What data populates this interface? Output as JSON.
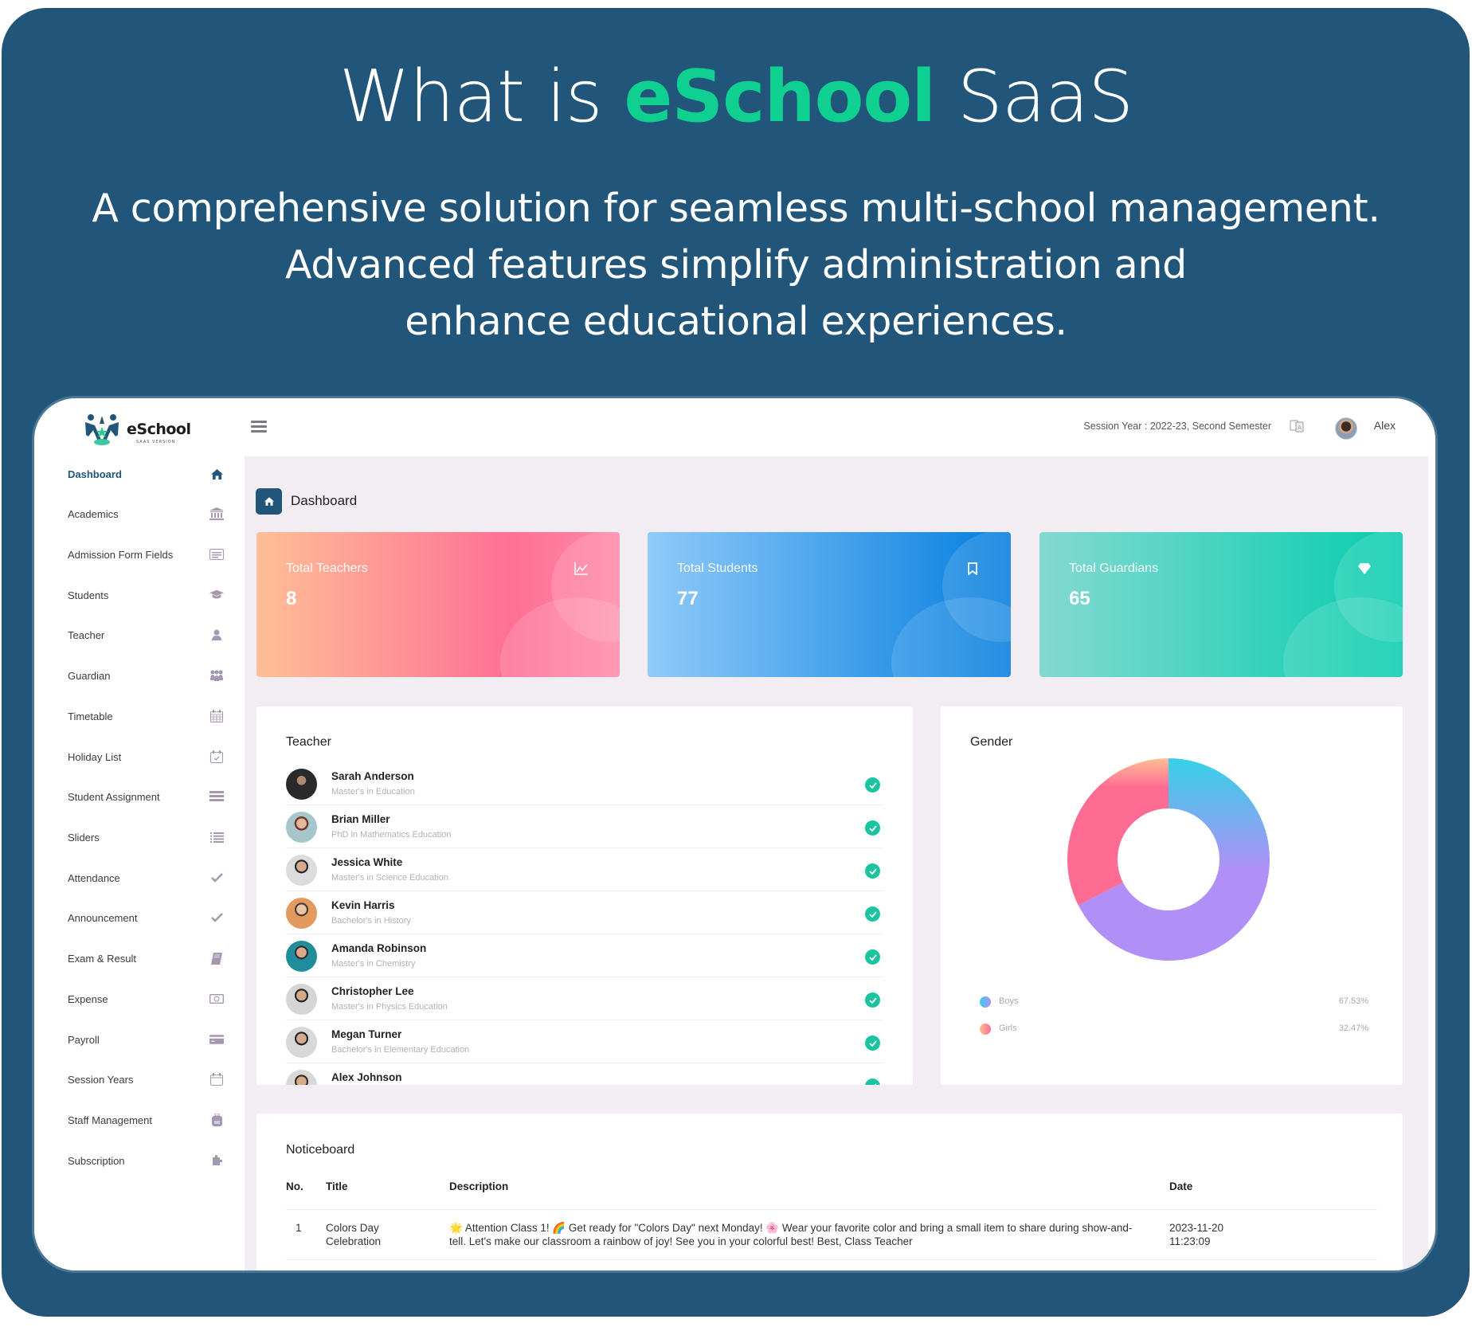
{
  "hero": {
    "title_prefix": "What is ",
    "title_accent": "eSchool",
    "title_suffix": " SaaS",
    "subtitle_lines": [
      "A comprehensive solution for seamless multi-school management.",
      "Advanced features simplify administration and",
      "enhance educational experiences."
    ],
    "colors": {
      "background": "#21567a",
      "accent": "#0fd090",
      "text": "#ffffff"
    }
  },
  "app": {
    "logo": {
      "name": "eSchool",
      "tagline": "SAAS VERSION"
    },
    "header": {
      "session_label": "Session Year : 2022-23, Second Semester",
      "language_icon": "translate-icon",
      "user_name": "Alex"
    },
    "sidebar": {
      "items": [
        {
          "label": "Dashboard",
          "icon": "home-icon",
          "active": true
        },
        {
          "label": "Academics",
          "icon": "university-icon"
        },
        {
          "label": "Admission Form Fields",
          "icon": "form-icon"
        },
        {
          "label": "Students",
          "icon": "graduation-cap-icon"
        },
        {
          "label": "Teacher",
          "icon": "user-icon"
        },
        {
          "label": "Guardian",
          "icon": "users-icon"
        },
        {
          "label": "Timetable",
          "icon": "calendar-grid-icon"
        },
        {
          "label": "Holiday List",
          "icon": "calendar-check-icon"
        },
        {
          "label": "Student Assignment",
          "icon": "assignment-list-icon"
        },
        {
          "label": "Sliders",
          "icon": "list-icon"
        },
        {
          "label": "Attendance",
          "icon": "check-icon"
        },
        {
          "label": "Announcement",
          "icon": "check-icon"
        },
        {
          "label": "Exam & Result",
          "icon": "book-icon"
        },
        {
          "label": "Expense",
          "icon": "money-icon"
        },
        {
          "label": "Payroll",
          "icon": "credit-card-icon"
        },
        {
          "label": "Session Years",
          "icon": "calendar-icon"
        },
        {
          "label": "Staff Management",
          "icon": "backpack-icon"
        },
        {
          "label": "Subscription",
          "icon": "puzzle-icon"
        }
      ]
    },
    "breadcrumb": {
      "title": "Dashboard",
      "icon": "home-icon"
    },
    "stats": [
      {
        "label": "Total Teachers",
        "value": "8",
        "icon": "line-chart-icon"
      },
      {
        "label": "Total Students",
        "value": "77",
        "icon": "bookmark-icon"
      },
      {
        "label": "Total Guardians",
        "value": "65",
        "icon": "diamond-icon"
      }
    ],
    "teachers": {
      "title": "Teacher",
      "rows": [
        {
          "name": "Sarah Anderson",
          "degree": "Master's in Education",
          "status": "active"
        },
        {
          "name": "Brian Miller",
          "degree": "PhD in Mathematics Education",
          "status": "active"
        },
        {
          "name": "Jessica White",
          "degree": "Master's in Science Education",
          "status": "active"
        },
        {
          "name": "Kevin Harris",
          "degree": "Bachelor's in History",
          "status": "active"
        },
        {
          "name": "Amanda Robinson",
          "degree": "Master's in Chemistry",
          "status": "active"
        },
        {
          "name": "Christopher Lee",
          "degree": "Master's in Physics Education",
          "status": "active"
        },
        {
          "name": "Megan Turner",
          "degree": "Bachelor's in Elementary Education",
          "status": "active"
        },
        {
          "name": "Alex Johnson",
          "degree": "",
          "status": "active"
        }
      ]
    },
    "gender": {
      "title": "Gender"
    },
    "noticeboard": {
      "title": "Noticeboard",
      "columns": [
        "No.",
        "Title",
        "Description",
        "Date"
      ],
      "rows": [
        {
          "no": "1",
          "title": "Colors Day Celebration",
          "description": "🌟 Attention Class 1! 🌈 Get ready for \"Colors Day\" next Monday! 🌸 Wear your favorite color and bring a small item to share during show-and-tell. Let's make our classroom a rainbow of joy! See you in your colorful best! Best, Class Teacher",
          "date_line1": "2023-11-20",
          "date_line2": "11:23:09"
        }
      ]
    }
  },
  "chart_data": {
    "type": "pie",
    "title": "Gender",
    "categories": [
      "Boys",
      "Girls"
    ],
    "values": [
      67.53,
      32.47
    ],
    "value_labels": [
      "67.53%",
      "32.47%"
    ],
    "donut": true,
    "legend": "bottom",
    "colors": {
      "Boys": [
        "#36d1e8",
        "#b08ff7"
      ],
      "Girls": [
        "#ffbf96",
        "#fe6b93"
      ]
    }
  }
}
